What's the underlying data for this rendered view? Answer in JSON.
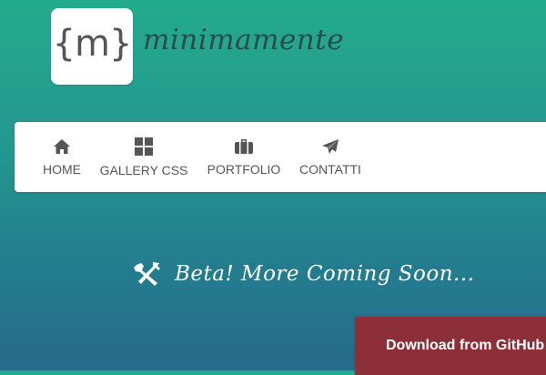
{
  "logo": {
    "mark": "{m}",
    "name": "minimamente"
  },
  "nav": {
    "items": [
      {
        "label": "HOME",
        "icon": "home-icon"
      },
      {
        "label": "GALLERY CSS",
        "icon": "grid-icon"
      },
      {
        "label": "PORTFOLIO",
        "icon": "briefcase-icon"
      },
      {
        "label": "CONTATTI",
        "icon": "paper-plane-icon"
      }
    ]
  },
  "banner": {
    "text": "Beta! More Coming Soon...",
    "icon": "tools-icon"
  },
  "cta": {
    "label": "Download from GitHub"
  },
  "colors": {
    "gradient_top": "#24ab8d",
    "gradient_bottom": "#266b8c",
    "nav_text": "#555555",
    "cta_background": "#8d2f39"
  }
}
